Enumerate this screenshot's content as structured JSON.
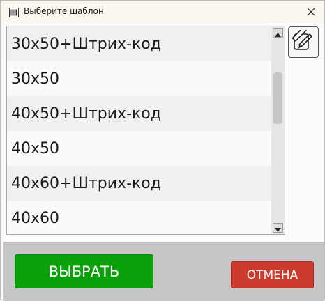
{
  "window": {
    "title": "Выберите шаблон",
    "icon": "barcode-app-icon",
    "close_icon": "close-icon"
  },
  "templates": [
    {
      "label": "30x50+Штрих-код"
    },
    {
      "label": "30x50"
    },
    {
      "label": "40x50+Штрих-код"
    },
    {
      "label": "40x50"
    },
    {
      "label": "40x60+Штрих-код"
    },
    {
      "label": "40x60"
    }
  ],
  "scrollbar": {
    "up_icon": "arrow-up-icon",
    "down_icon": "arrow-down-icon"
  },
  "edit": {
    "icon": "pencil-edit-icon"
  },
  "buttons": {
    "select_label": "ВЫБРАТЬ",
    "cancel_label": "ОТМЕНА"
  },
  "colors": {
    "select_button": "#0aa00a",
    "cancel_button": "#cc3a2e",
    "bottom_bar": "#c6c6c6"
  }
}
